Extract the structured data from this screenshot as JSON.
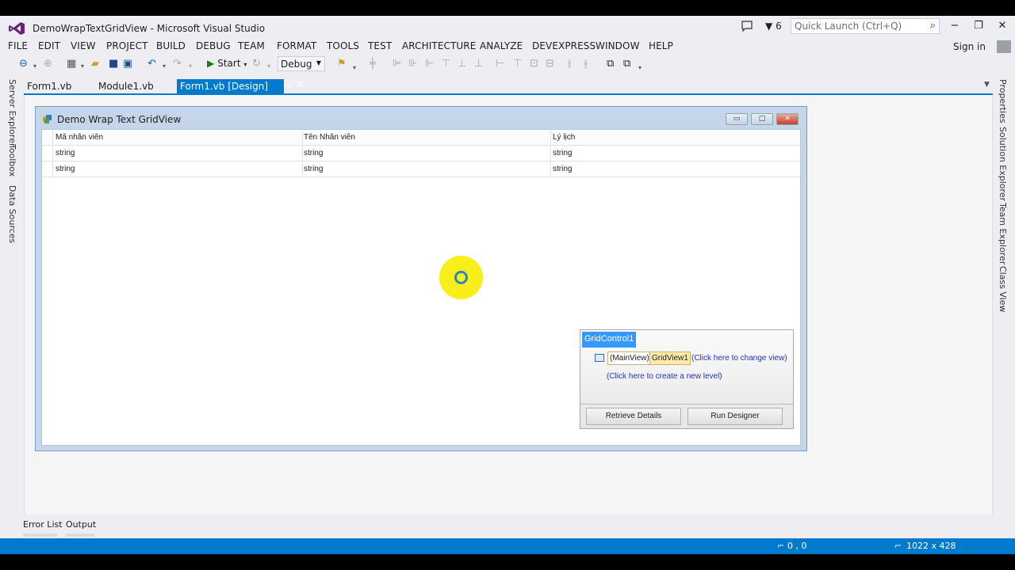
{
  "window": {
    "title": "DemoWrapTextGridView - Microsoft Visual Studio",
    "notifications_count": "6",
    "quick_launch_placeholder": "Quick Launch (Ctrl+Q)",
    "sign_in": "Sign in"
  },
  "menu": [
    "FILE",
    "EDIT",
    "VIEW",
    "PROJECT",
    "BUILD",
    "DEBUG",
    "TEAM",
    "FORMAT",
    "TOOLS",
    "TEST",
    "ARCHITECTURE",
    "ANALYZE",
    "DEVEXPRESS",
    "WINDOW",
    "HELP"
  ],
  "toolbar": {
    "start_label": "Start",
    "config_value": "Debug"
  },
  "tabs": {
    "tab1": "Form1.vb",
    "tab2": "Module1.vb",
    "active": "Form1.vb [Design]"
  },
  "left_rail": [
    "Server Explorer",
    "Toolbox",
    "Data Sources"
  ],
  "right_rail": [
    "Properties",
    "Solution Explorer",
    "Team Explorer",
    "Class View"
  ],
  "form": {
    "title": "Demo Wrap Text GridView",
    "columns": [
      "Mã nhân viên",
      "Tên Nhân viên",
      "Lý lịch"
    ],
    "rows": [
      [
        "string",
        "string",
        "string"
      ],
      [
        "string",
        "string",
        "string"
      ]
    ]
  },
  "smart_panel": {
    "title": "GridControl1",
    "main_view": "(MainView)",
    "grid_view": "GridView1",
    "change_view": "(Click here to change view)",
    "new_level": "(Click here to create a new level)",
    "retrieve": "Retrieve Details",
    "run_designer": "Run Designer"
  },
  "bottom_tabs": {
    "error_list": "Error List",
    "output": "Output"
  },
  "status": {
    "position": "0 , 0",
    "size": "1022 x 428"
  },
  "colors": {
    "accent": "#007acc",
    "form_border": "#7a9cc8",
    "cursor_highlight": "#f8ee1a"
  }
}
